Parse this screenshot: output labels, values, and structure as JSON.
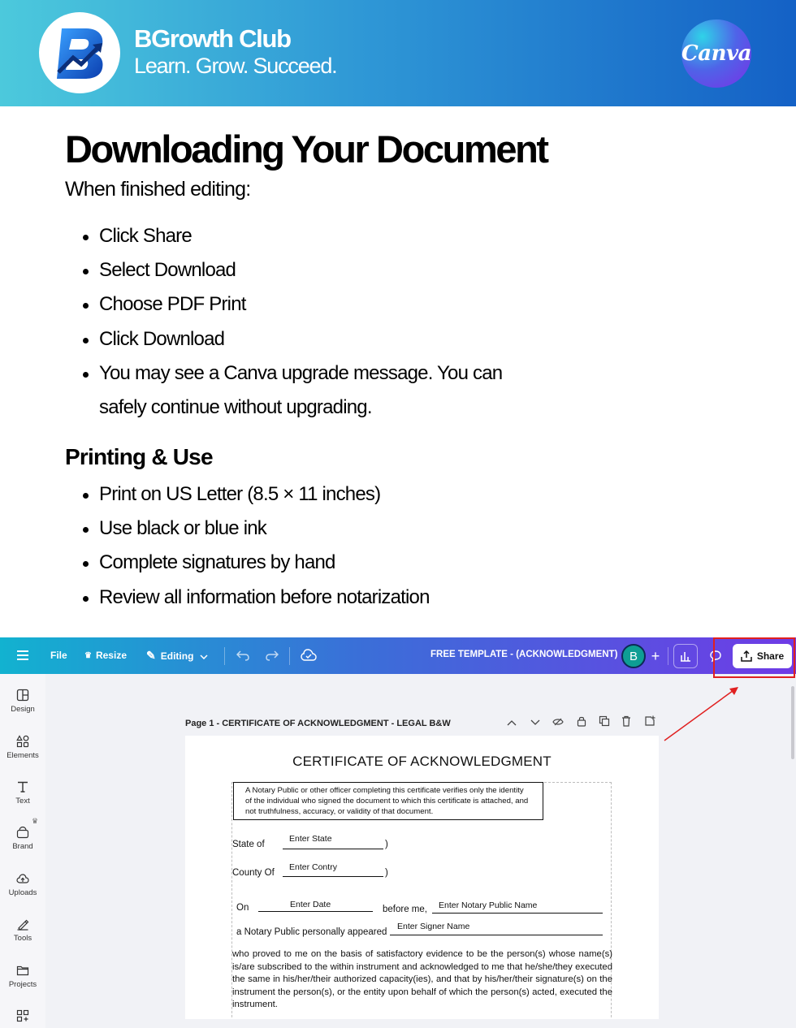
{
  "colors": {
    "banner_start": "#4cc9dc",
    "banner_end": "#1461c6",
    "canva_topbar_start": "#12b2d0",
    "canva_topbar_end": "#6f3be6",
    "highlight": "#e02020",
    "avatar": "#0e9e94"
  },
  "banner": {
    "logo_icon": "bgrowth-logo-icon",
    "brand_name": "BGrowth Club",
    "tagline": "Learn. Grow. Succeed.",
    "canva_badge": "Canva"
  },
  "instructions": {
    "title": "Downloading Your Document",
    "intro": "When finished editing:",
    "steps": [
      "Click Share",
      "Select Download",
      "Choose PDF Print",
      "Click Download",
      "You may see a Canva upgrade message. You can safely continue without upgrading."
    ],
    "print_heading": "Printing & Use",
    "print_items": [
      "Print on US Letter (8.5 × 11 inches)",
      "Use black or blue ink",
      "Complete signatures by hand",
      "Review all information before notarization"
    ]
  },
  "canva": {
    "topbar": {
      "menu_icon": "hamburger-icon",
      "file": "File",
      "resize": "Resize",
      "editing": "Editing",
      "doc_title": "FREE TEMPLATE - (ACKNOWLEDGMENT)",
      "avatar_letter": "B",
      "share": "Share"
    },
    "sidebar": [
      "Design",
      "Elements",
      "Text",
      "Brand",
      "Uploads",
      "Tools",
      "Projects"
    ],
    "page_label": "Page 1 - CERTIFICATE OF ACKNOWLEDGMENT - LEGAL B&W",
    "document": {
      "title": "CERTIFICATE OF ACKNOWLEDGMENT",
      "notice_lines": [
        "A Notary Public or other officer completing this certificate verifies only the identity",
        "of the individual who signed the document to which this certificate is attached, and",
        "not truthfulness, accuracy, or validity of that document."
      ],
      "state_label": "State of",
      "state_field": "Enter State",
      "county_label": "County Of",
      "county_field": "Enter Contry",
      "paren": ")",
      "on_label": "On",
      "date_field": "Enter Date",
      "before_me": "before me,",
      "notary_field": "Enter Notary Public Name",
      "appeared_label": "a Notary Public personally appeared",
      "signer_field": "Enter Signer Name",
      "paragraph": "who proved to me on the basis of satisfactory evidence to be the person(s) whose name(s) is/are subscribed to the within instrument and acknowledged to me that he/she/they executed the same in his/her/their authorized capacity(ies), and that by his/her/their signature(s) on the instrument the person(s), or the entity upon behalf of which the person(s) acted, executed the instrument."
    }
  }
}
